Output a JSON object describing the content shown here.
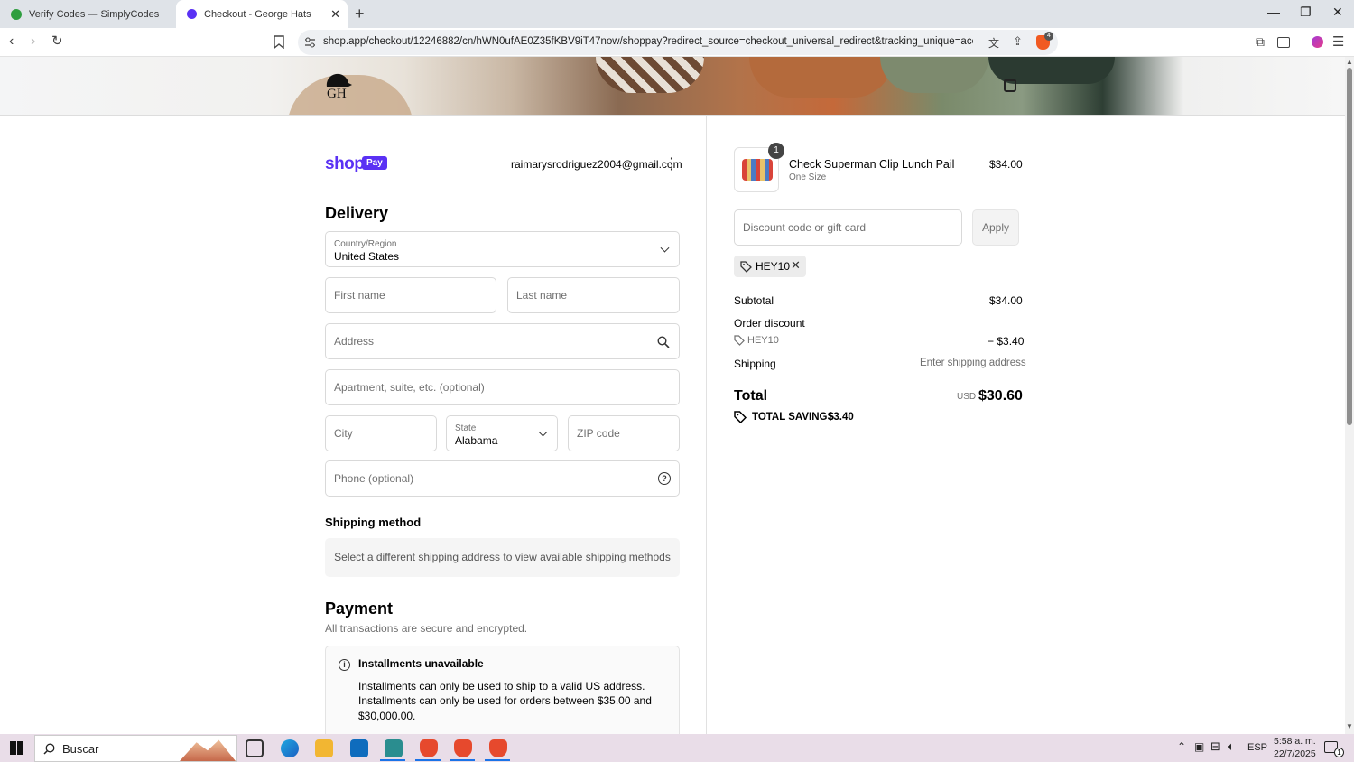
{
  "browser": {
    "tabs": [
      {
        "title": "Verify Codes — SimplyCodes",
        "active": false,
        "favicon_color": "#2e9e3f"
      },
      {
        "title": "Checkout - George Hats",
        "active": true,
        "favicon_color": "#5a31f4"
      }
    ],
    "url": "shop.app/checkout/12246882/cn/hWN0ufAE0Z35fKBV9iT47now/shoppay?redirect_source=checkout_universal_redirect&tracking_unique=ace0f99c-...",
    "brave_badge": "4"
  },
  "header": {
    "logo_text": "GH"
  },
  "shop_pay": {
    "brand": "shop",
    "pay_badge": "Pay",
    "email": "raimarysrodriguez2004@gmail.com"
  },
  "delivery": {
    "heading": "Delivery",
    "country_label": "Country/Region",
    "country_value": "United States",
    "first_name_placeholder": "First name",
    "last_name_placeholder": "Last name",
    "address_placeholder": "Address",
    "apartment_placeholder": "Apartment, suite, etc. (optional)",
    "city_placeholder": "City",
    "state_label": "State",
    "state_value": "Alabama",
    "zip_placeholder": "ZIP code",
    "phone_placeholder": "Phone (optional)"
  },
  "shipping_method": {
    "heading": "Shipping method",
    "message": "Select a different shipping address to view available shipping methods"
  },
  "payment": {
    "heading": "Payment",
    "subtext": "All transactions are secure and encrypted.",
    "notice_title": "Installments unavailable",
    "notice_line1": "Installments can only be used to ship to a valid US address.",
    "notice_line2": "Installments can only be used for orders between $35.00 and",
    "notice_line3": "$30,000.00."
  },
  "summary": {
    "item_qty": "1",
    "item_name": "Check Superman Clip Lunch Pail",
    "item_variant": "One Size",
    "item_price": "$34.00",
    "discount_placeholder": "Discount code or gift card",
    "apply_label": "Apply",
    "applied_code": "HEY10",
    "subtotal_label": "Subtotal",
    "subtotal_value": "$34.00",
    "order_discount_label": "Order discount",
    "discount_code": "HEY10",
    "discount_value": "− $3.40",
    "shipping_label": "Shipping",
    "shipping_value": "Enter shipping address",
    "total_label": "Total",
    "currency": "USD",
    "total_value": "$30.60",
    "savings_label": "TOTAL SAVINGS",
    "savings_value": "$3.40"
  },
  "taskbar": {
    "search_placeholder": "Buscar",
    "language": "ESP",
    "time": "5:58 a. m.",
    "date": "22/7/2025",
    "notification_count": "1"
  },
  "colors": {
    "shop_purple": "#5a31f4",
    "accent_text": "#000000",
    "muted_text": "#707070"
  }
}
